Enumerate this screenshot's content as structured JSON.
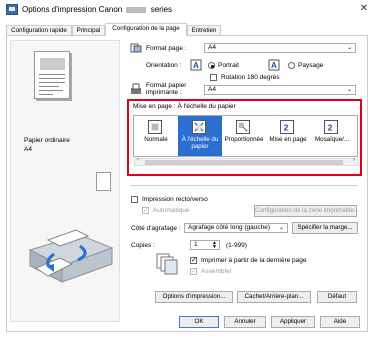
{
  "window": {
    "title_prefix": "Options d'impression Canon",
    "title_suffix": "series",
    "close": "✕"
  },
  "tabs": [
    {
      "label": "Configuration rapide"
    },
    {
      "label": "Principal"
    },
    {
      "label": "Configuration de la page"
    },
    {
      "label": "Entretien"
    }
  ],
  "preview": {
    "media": "Papier ordinaire",
    "size": "A4"
  },
  "page_setup": {
    "format_label": "Format page :",
    "format_value": "A4",
    "orientation_label": "Orientation :",
    "portrait": "Portrait",
    "landscape": "Paysage",
    "rotate180": "Rotation 180 degrés",
    "printer_paper_label_1": "Format papier",
    "printer_paper_label_2": "imprimante :",
    "printer_paper_value": "A4"
  },
  "layout": {
    "heading": "Mise en page : À l'échelle du papier",
    "items": [
      {
        "label": "Normale"
      },
      {
        "label": "À l'échelle du papier"
      },
      {
        "label": "Proportionnée"
      },
      {
        "label": "Mise en page"
      },
      {
        "label": "Mosaïque/..."
      }
    ]
  },
  "duplex": {
    "label": "Impression recto/verso",
    "auto": "Automatique",
    "config_button": "Configuration de la zone imprimable..."
  },
  "stapling": {
    "label": "Côté d'agrafage :",
    "value": "Agrafage côté long (gauche)",
    "margin_button": "Spécifier la marge..."
  },
  "copies": {
    "label": "Copies :",
    "value": "1",
    "range": "(1-999)",
    "last_page": "Imprimer à partir de la dernière page",
    "collate": "Assembler"
  },
  "bottom_buttons": {
    "options": "Options d'impression...",
    "stamp": "Cachet/Arrière-plan...",
    "default": "Défaut"
  },
  "dialog_buttons": {
    "ok": "OK",
    "cancel": "Annuler",
    "apply": "Appliquer",
    "help": "Aide"
  },
  "icons": [
    "printer-icon",
    "close-icon",
    "portrait-icon",
    "landscape-icon",
    "printer-paper-icon",
    "layout-normal-icon",
    "layout-fit-icon",
    "layout-scaled-icon",
    "layout-page-icon",
    "layout-poster-icon",
    "copies-icon"
  ],
  "colors": {
    "highlight": "#e0001b",
    "selection": "#2b6fd1"
  }
}
